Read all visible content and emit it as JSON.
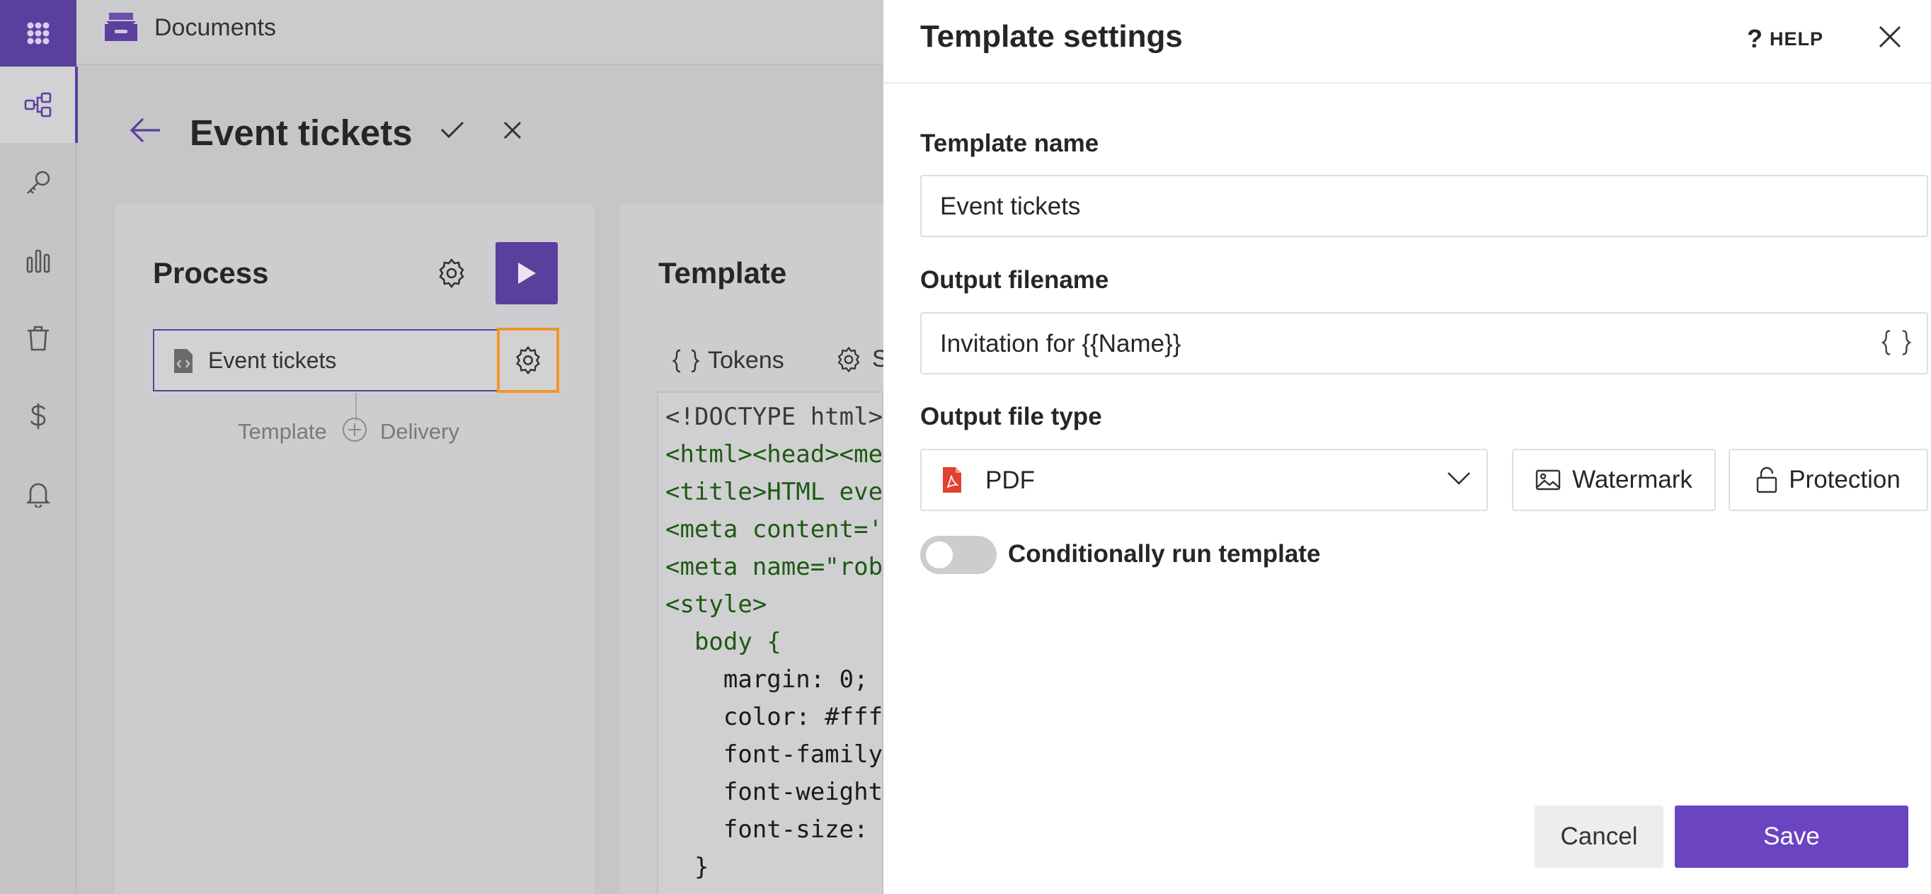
{
  "app": {
    "module_title": "Documents",
    "sidebar": {
      "items": [
        {
          "icon": "apps-grid-icon"
        },
        {
          "icon": "workflow-icon",
          "active": true
        },
        {
          "icon": "key-icon"
        },
        {
          "icon": "bar-chart-icon"
        },
        {
          "icon": "trash-icon"
        },
        {
          "icon": "dollar-icon"
        },
        {
          "icon": "bell-icon"
        }
      ]
    },
    "page": {
      "title": "Event tickets"
    },
    "process": {
      "heading": "Process",
      "step_label": "Event tickets",
      "connector_left": "Template",
      "connector_right": "Delivery"
    },
    "template": {
      "heading": "Template",
      "tabs": [
        {
          "label": "Tokens"
        },
        {
          "label": "S"
        }
      ],
      "code_lines": [
        "<!DOCTYPE html>",
        "<html><head><me",
        "<title>HTML eve",
        "<meta content='",
        "<meta name=\"rob",
        "<style>",
        "  body {",
        "    margin: 0;",
        "    color: #fff",
        "    font-family",
        "    font-weight",
        "    font-size:",
        "  }"
      ]
    }
  },
  "drawer": {
    "title": "Template settings",
    "help_label": "HELP",
    "help_glyph": "?",
    "template_name": {
      "label": "Template name",
      "value": "Event tickets"
    },
    "output_filename": {
      "label": "Output filename",
      "value": "Invitation for {{Name}}"
    },
    "output_file_type": {
      "label": "Output file type",
      "selected": "PDF",
      "watermark_label": "Watermark",
      "protection_label": "Protection"
    },
    "conditional": {
      "label": "Conditionally run template",
      "enabled": false
    },
    "cancel_label": "Cancel",
    "save_label": "Save"
  },
  "colors": {
    "brand_purple": "#5b3f9d",
    "save_purple": "#6a44c1",
    "highlight_orange": "#f0962a",
    "pdf_red": "#e2412f"
  }
}
